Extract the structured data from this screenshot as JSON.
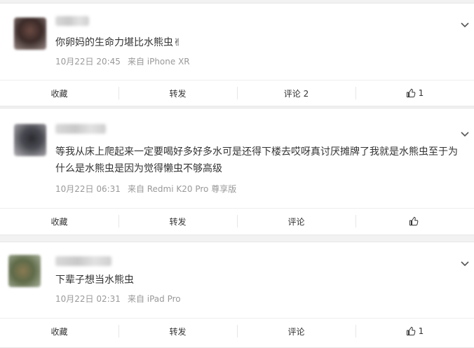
{
  "comments": [
    {
      "text": "你卵妈的生命力堪比水熊虫✌",
      "date": "10月22日 20:45",
      "source": "来自 iPhone XR",
      "actions": {
        "collect": "收藏",
        "repost": "转发",
        "comment": "评论 2",
        "like": "1"
      }
    },
    {
      "text": "等我从床上爬起来一定要喝好多好多水可是还得下楼去哎呀真讨厌摊牌了我就是水熊虫至于为什么是水熊虫是因为觉得懒虫不够高级",
      "date": "10月22日 06:31",
      "source": "来自 Redmi K20 Pro 尊享版",
      "actions": {
        "collect": "收藏",
        "repost": "转发",
        "comment": "评论",
        "like": ""
      }
    },
    {
      "text": "下辈子想当水熊虫",
      "date": "10月22日 02:31",
      "source": "来自 iPad Pro",
      "actions": {
        "collect": "收藏",
        "repost": "转发",
        "comment": "评论",
        "like": "1"
      }
    }
  ],
  "icons": {
    "menu": "chevron-down-icon",
    "like": "thumbs-up-icon"
  }
}
